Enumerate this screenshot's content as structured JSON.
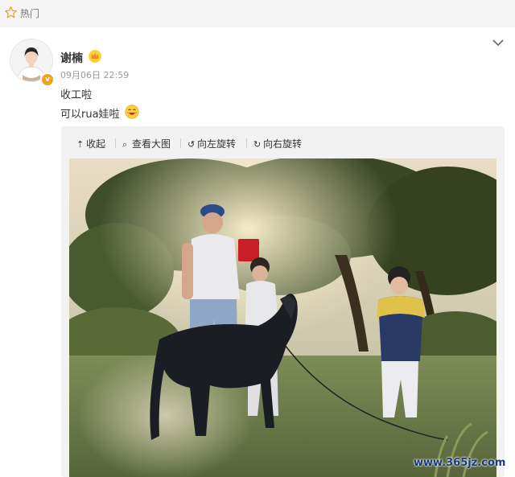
{
  "top_bar": {
    "label": "热门",
    "icon": "star-outline-icon"
  },
  "post": {
    "author": "谢楠",
    "timestamp": "09月06日 22:59",
    "lines": [
      "收工啦",
      "可以rua娃啦"
    ]
  },
  "media_toolbar": {
    "collapse": "收起",
    "view_large": "查看大图",
    "rotate_left": "向左旋转",
    "rotate_right": "向右旋转"
  },
  "watermark": "www.365jz.com",
  "colors": {
    "top_bar_bg": "#f5f5f5",
    "media_bg": "#f2f2f2",
    "verified_badge": "#f0a21b",
    "watermark": "#1a3a7a"
  }
}
